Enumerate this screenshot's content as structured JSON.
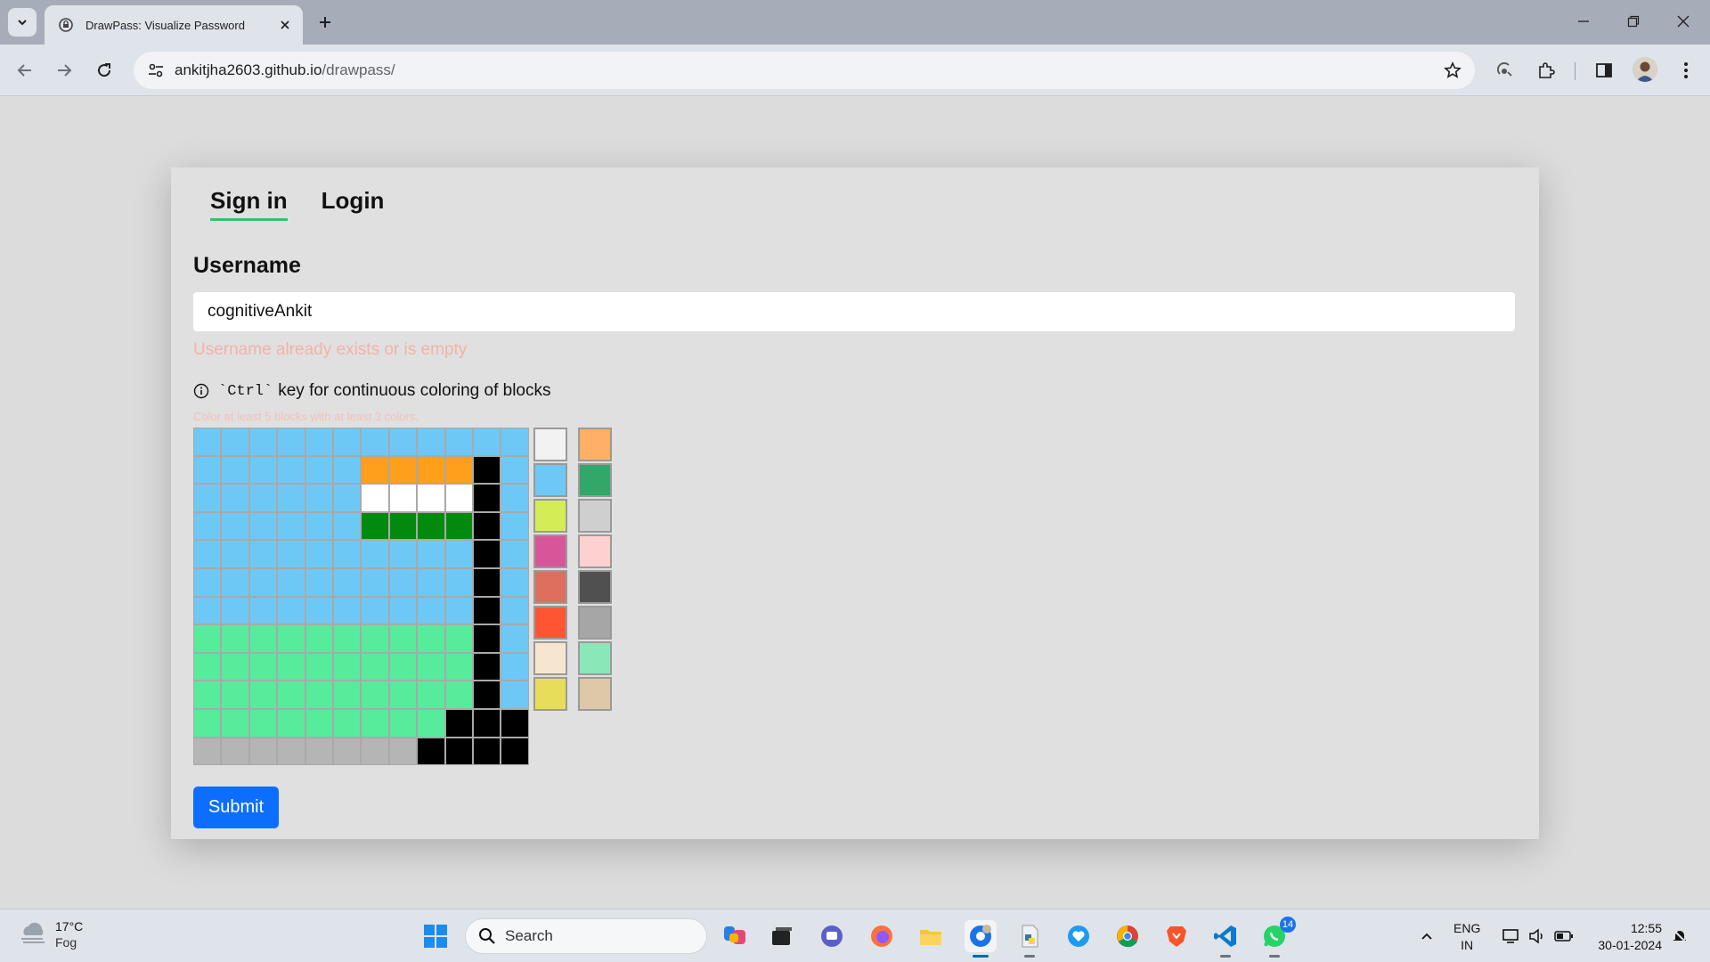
{
  "browser": {
    "tab_title": "DrawPass: Visualize Password",
    "url_host": "ankitjha2603.github.io",
    "url_path": "/drawpass/"
  },
  "page": {
    "tabs": [
      {
        "label": "Sign in",
        "active": true
      },
      {
        "label": "Login",
        "active": false
      }
    ],
    "username_label": "Username",
    "username_value": "cognitiveAnkit",
    "username_error": "Username already exists or is empty",
    "hint_prefix": "`Ctrl`",
    "hint_text": "key for continuous coloring of blocks",
    "subhint": "Color at least 5 blocks with at least 3 colors.",
    "submit_label": "Submit"
  },
  "colors": {
    "B": "#6ec8f5",
    "O": "#ff9f1c",
    "W": "#ffffff",
    "G": "#028a0f",
    "K": "#000000",
    "M": "#57eb9c",
    "S": "#b5b5b5",
    "accent": "#0d6efd",
    "tab_underline": "#2fc46a"
  },
  "grid_rows": [
    "BBBBBBBBBBBB",
    "BBBBBBOOOOKB",
    "BBBBBBWWWWKB",
    "BBBBBBGGGGKB",
    "BBBBBBBBBBKB",
    "BBBBBBBBBBKB",
    "BBBBBBBBBBKB",
    "MMMMMMMMMMKB",
    "MMMMMMMMMMKB",
    "MMMMMMMMMMKB",
    "MMMMMMMMMKKK",
    "SSSSSSSSKKKK"
  ],
  "palette": [
    "#f2f2f2",
    "#ffb066",
    "#6ec8f5",
    "#32a868",
    "#d4ed57",
    "#cfcfcf",
    "#d9559a",
    "#ffd0d0",
    "#de6f5f",
    "#505050",
    "#ff5533",
    "#a6a6a6",
    "#f7e6cf",
    "#8ae8b8",
    "#e8dd5a",
    "#ddc8a8"
  ],
  "taskbar": {
    "weather_temp": "17°C",
    "weather_cond": "Fog",
    "search_placeholder": "Search",
    "whatsapp_badge": "14",
    "lang_line1": "ENG",
    "lang_line2": "IN",
    "time": "12:55",
    "date": "30-01-2024"
  }
}
